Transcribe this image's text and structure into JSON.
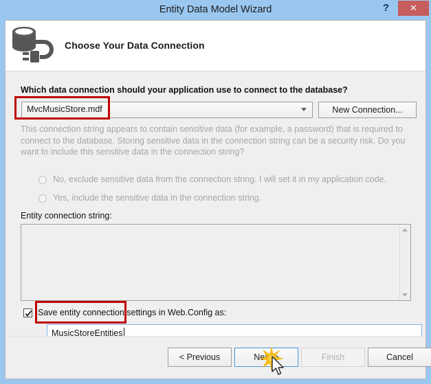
{
  "window": {
    "title": "Entity Data Model Wizard",
    "help_label": "?",
    "close_label": "✕"
  },
  "header": {
    "title": "Choose Your Data Connection",
    "icon": "database-connection-icon"
  },
  "main": {
    "question_label": "Which data connection should your application use to connect to the database?",
    "connection_dropdown": {
      "selected": "MvcMusicStore.mdf",
      "options": [
        "MvcMusicStore.mdf"
      ],
      "caret_icon": "chevron-down-icon"
    },
    "new_connection_button": "New Connection...",
    "sensitive_data_text": "This connection string appears to contain sensitive data (for example, a password) that is required to connect to the database. Storing sensitive data in the connection string can be a security risk. Do you want to include this sensitive data in the connection string?",
    "radios": [
      {
        "label": "No, exclude sensitive data from the connection string. I will set it in my application code.",
        "checked": false,
        "disabled": true
      },
      {
        "label": "Yes, include the sensitive data in the connection string.",
        "checked": false,
        "disabled": true
      }
    ],
    "entity_connection_string_label": "Entity connection string:",
    "entity_connection_string_value": "",
    "scrollbar": {
      "up_icon": "chevron-up-icon",
      "down_icon": "chevron-down-icon"
    },
    "save_checkbox": {
      "label": "Save entity connection settings in Web.Config as:",
      "checked": true,
      "check_icon": "check-icon"
    },
    "entities_input_value": "MusicStoreEntities"
  },
  "footer": {
    "previous_button": "< Previous",
    "next_button": "Next >",
    "finish_button": "Finish",
    "cancel_button": "Cancel"
  },
  "annotations": {
    "highlight_color": "#c00000",
    "click_indicator": "click-burst-icon",
    "cursor": "mouse-pointer-icon"
  },
  "colors": {
    "titlebar": "#9ac7f0",
    "close_button": "#c75c5c",
    "body": "#efefef",
    "focus_border": "#3f8fd8",
    "disabled_text": "#a6a6a6"
  }
}
